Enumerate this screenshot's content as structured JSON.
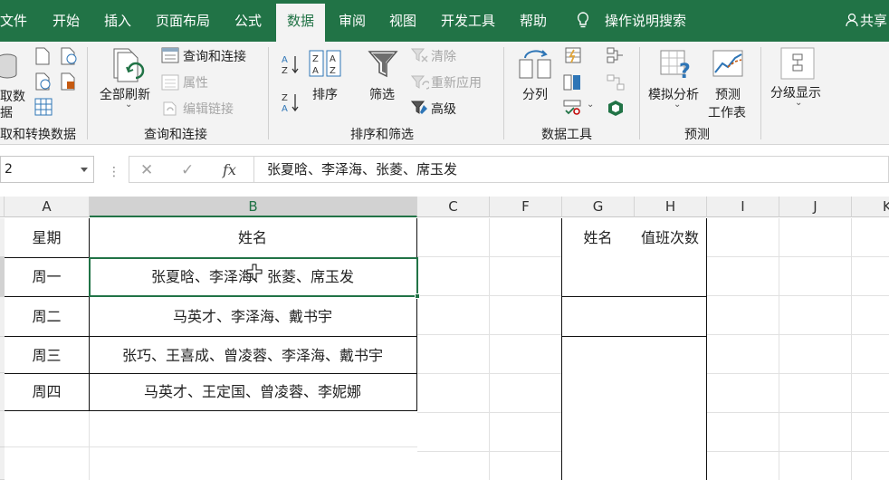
{
  "tabs": [
    "文件",
    "开始",
    "插入",
    "页面布局",
    "公式",
    "数据",
    "审阅",
    "视图",
    "开发工具",
    "帮助"
  ],
  "active_tab": "数据",
  "tell_me": "操作说明搜索",
  "share": "共享",
  "colors": {
    "brand": "#217346",
    "ribbon_bg": "#f3f3f3",
    "header_bg": "#f0f0f0"
  },
  "ribbon": {
    "get_data": {
      "label1": "取数",
      "label2": "据",
      "group": "取和转换数据"
    },
    "queries": {
      "refresh_all": "全部刷新",
      "queries_connections": "查询和连接",
      "properties": "属性",
      "edit_links": "编辑链接",
      "group": "查询和连接"
    },
    "sort_filter": {
      "sort": "排序",
      "filter": "筛选",
      "clear": "清除",
      "reapply": "重新应用",
      "advanced": "高级",
      "group": "排序和筛选"
    },
    "data_tools": {
      "text_to_columns": "分列",
      "group": "数据工具"
    },
    "forecast": {
      "what_if": "模拟分析",
      "forecast_sheet1": "预测",
      "forecast_sheet2": "工作表",
      "group": "预测"
    },
    "outline": {
      "label": "分级显示"
    }
  },
  "formula_bar": {
    "name_box": "2",
    "cancel": "✕",
    "enter": "✓",
    "fx": "fx",
    "value": "张夏晗、李泽海、张菱、席玉发"
  },
  "columns": [
    "A",
    "B",
    "C",
    "F",
    "G",
    "H",
    "I",
    "J",
    "K"
  ],
  "table": {
    "header": [
      "星期",
      "姓名"
    ],
    "rows": [
      [
        "周一",
        "张夏晗、李泽海、张菱、席玉发"
      ],
      [
        "周二",
        "马英才、李泽海、戴书宇"
      ],
      [
        "周三",
        "张巧、王喜成、曾凌蓉、李泽海、戴书宇"
      ],
      [
        "周四",
        "马英才、王定国、曾凌蓉、李妮娜"
      ]
    ]
  },
  "side_table": {
    "header": [
      "姓名",
      "值班次数"
    ]
  }
}
